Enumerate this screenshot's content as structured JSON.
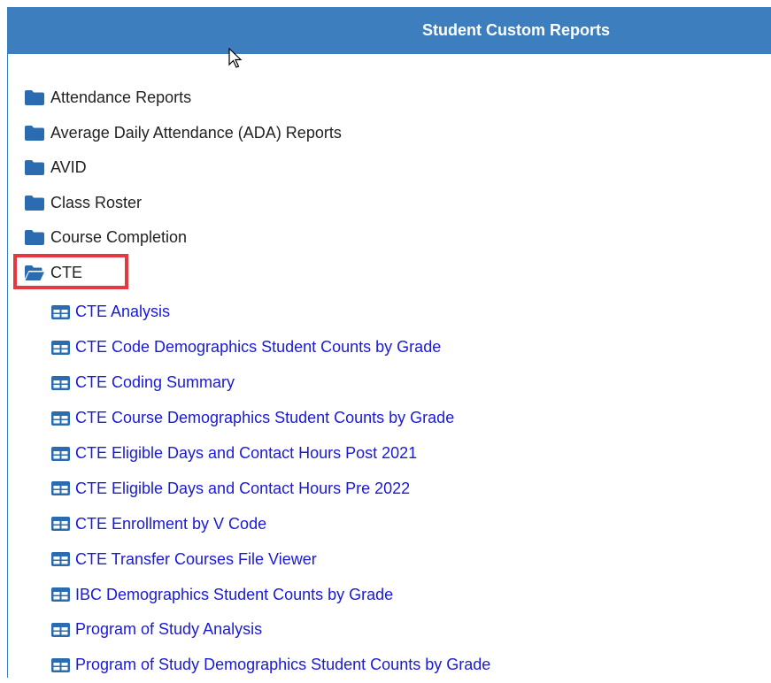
{
  "header": {
    "title": "Student Custom Reports"
  },
  "colors": {
    "header_bg": "#3d7ebf",
    "folder": "#2b6cb0",
    "link": "#1a1ad6",
    "highlight": "#e5393f"
  },
  "folders": [
    {
      "label": "Attendance Reports",
      "icon": "folder-closed-icon"
    },
    {
      "label": "Average Daily Attendance (ADA) Reports",
      "icon": "folder-closed-icon"
    },
    {
      "label": "AVID",
      "icon": "folder-closed-icon"
    },
    {
      "label": "Class Roster",
      "icon": "folder-closed-icon"
    },
    {
      "label": "Course Completion",
      "icon": "folder-closed-icon"
    },
    {
      "label": "CTE",
      "icon": "folder-open-icon"
    }
  ],
  "reports": [
    {
      "label": "CTE Analysis",
      "icon": "table-icon"
    },
    {
      "label": "CTE Code Demographics Student Counts by Grade",
      "icon": "table-icon"
    },
    {
      "label": "CTE Coding Summary",
      "icon": "table-icon"
    },
    {
      "label": "CTE Course Demographics Student Counts by Grade",
      "icon": "table-icon"
    },
    {
      "label": "CTE Eligible Days and Contact Hours Post 2021",
      "icon": "table-icon"
    },
    {
      "label": "CTE Eligible Days and Contact Hours Pre 2022",
      "icon": "table-icon"
    },
    {
      "label": "CTE Enrollment by V Code",
      "icon": "table-icon"
    },
    {
      "label": "CTE Transfer Courses File Viewer",
      "icon": "table-icon"
    },
    {
      "label": "IBC Demographics Student Counts by Grade",
      "icon": "table-icon"
    },
    {
      "label": "Program of Study Analysis",
      "icon": "table-icon"
    },
    {
      "label": "Program of Study Demographics Student Counts by Grade",
      "icon": "table-icon"
    }
  ]
}
